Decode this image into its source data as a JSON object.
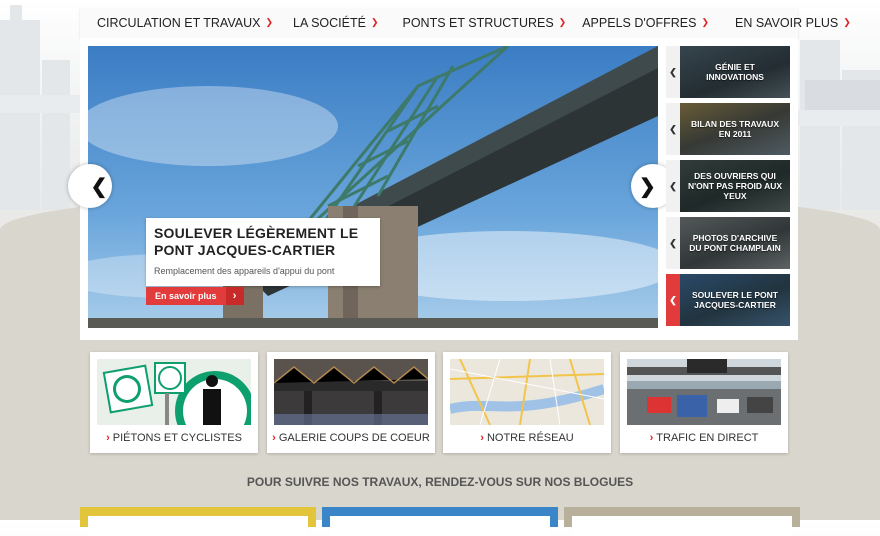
{
  "nav": {
    "items": [
      {
        "label": "CIRCULATION ET TRAVAUX"
      },
      {
        "label": "LA SOCIÉTÉ"
      },
      {
        "label": "PONTS ET STRUCTURES"
      },
      {
        "label": "APPELS D'OFFRES"
      },
      {
        "label": "EN SAVOIR PLUS"
      }
    ]
  },
  "hero": {
    "title": "SOULEVER LÉGÈREMENT LE PONT JACQUES-CARTIER",
    "subtitle": "Remplacement des appareils d'appui du pont",
    "cta": "En savoir plus",
    "prev_icon": "chevron-left-icon",
    "next_icon": "chevron-right-icon"
  },
  "thumbs": [
    {
      "label": "GÉNIE ET INNOVATIONS",
      "active": false
    },
    {
      "label": "BILAN DES TRAVAUX EN 2011",
      "active": false
    },
    {
      "label": "DES OUVRIERS QUI N'ONT PAS FROID AUX YEUX",
      "active": false
    },
    {
      "label": "PHOTOS D'ARCHIVE DU PONT CHAMPLAIN",
      "active": false
    },
    {
      "label": "SOULEVER LE PONT JACQUES-CARTIER",
      "active": true
    }
  ],
  "cards": [
    {
      "label": "PIÉTONS ET CYCLISTES"
    },
    {
      "label": "GALERIE COUPS DE COEUR"
    },
    {
      "label": "NOTRE RÉSEAU"
    },
    {
      "label": "TRAFIC EN DIRECT"
    }
  ],
  "blogs_heading": "POUR SUIVRE NOS TRAVAUX, RENDEZ-VOUS SUR NOS BLOGUES",
  "colors": {
    "accent": "#e23b3b",
    "nav_bg": "#fafafa",
    "blog1": "#e2c53b",
    "blog2": "#3a86c8",
    "blog3": "#b8b09a"
  }
}
